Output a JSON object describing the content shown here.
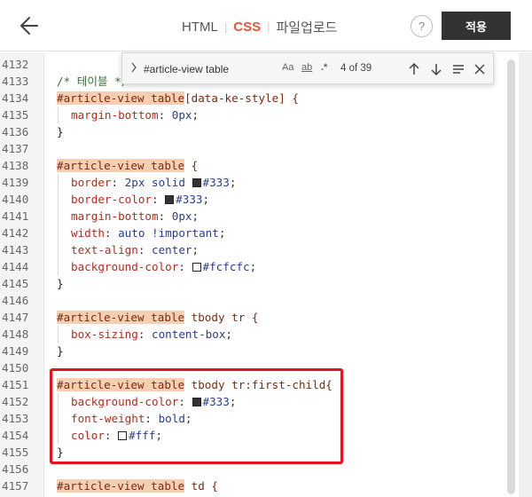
{
  "header": {
    "tabs": [
      {
        "label": "HTML",
        "active": false
      },
      {
        "label": "CSS",
        "active": true
      },
      {
        "label": "파일업로드",
        "active": false
      }
    ],
    "help_label": "?",
    "apply_label": "적용"
  },
  "find": {
    "query": "#article-view table",
    "match_case_label": "Aa",
    "whole_word_label": "ab",
    "regex_label": ".*",
    "count": "4 of 39"
  },
  "colors": {
    "accent": "#f0533a",
    "apply_bg": "#333333",
    "selector_highlight": "#f6cfb3",
    "annotation_red": "#e4141d"
  },
  "code": {
    "lines": [
      {
        "n": "4132",
        "t": ""
      },
      {
        "n": "4133",
        "t": "/* 테이블 */"
      },
      {
        "n": "4134",
        "sel_hl": "#article-view table",
        "sel_rest": "[data-ke-style] {"
      },
      {
        "n": "4135",
        "prop": "margin-bottom",
        "val": "0px"
      },
      {
        "n": "4136",
        "brace": "}"
      },
      {
        "n": "4137",
        "t": ""
      },
      {
        "n": "4138",
        "sel_hl": "#article-view table",
        "sel_rest": " {"
      },
      {
        "n": "4139",
        "prop": "border",
        "val_pre": "2px solid ",
        "color": "#333",
        "val": "#333"
      },
      {
        "n": "4140",
        "prop": "border-color",
        "color": "#333",
        "val": "#333"
      },
      {
        "n": "4141",
        "prop": "margin-bottom",
        "val": "0px"
      },
      {
        "n": "4142",
        "prop": "width",
        "val": "auto !important"
      },
      {
        "n": "4143",
        "prop": "text-align",
        "val": "center"
      },
      {
        "n": "4144",
        "prop": "background-color",
        "color": "#fcfcfc",
        "val": "#fcfcfc"
      },
      {
        "n": "4145",
        "brace": "}"
      },
      {
        "n": "4146",
        "t": ""
      },
      {
        "n": "4147",
        "sel_hl": "#article-view table",
        "sel_rest": " tbody tr {"
      },
      {
        "n": "4148",
        "prop": "box-sizing",
        "val": "content-box"
      },
      {
        "n": "4149",
        "brace": "}"
      },
      {
        "n": "4150",
        "t": ""
      },
      {
        "n": "4151",
        "sel_hl": "#article-view table",
        "sel_rest": " tbody tr:first-child{"
      },
      {
        "n": "4152",
        "prop": "background-color",
        "color": "#333",
        "val": "#333"
      },
      {
        "n": "4153",
        "prop": "font-weight",
        "val": "bold"
      },
      {
        "n": "4154",
        "prop": "color",
        "color": "#fff",
        "val": "#fff"
      },
      {
        "n": "4155",
        "brace": "}"
      },
      {
        "n": "4156",
        "t": ""
      },
      {
        "n": "4157",
        "sel_hl": "#article-view table",
        "sel_rest": " td {"
      }
    ]
  }
}
